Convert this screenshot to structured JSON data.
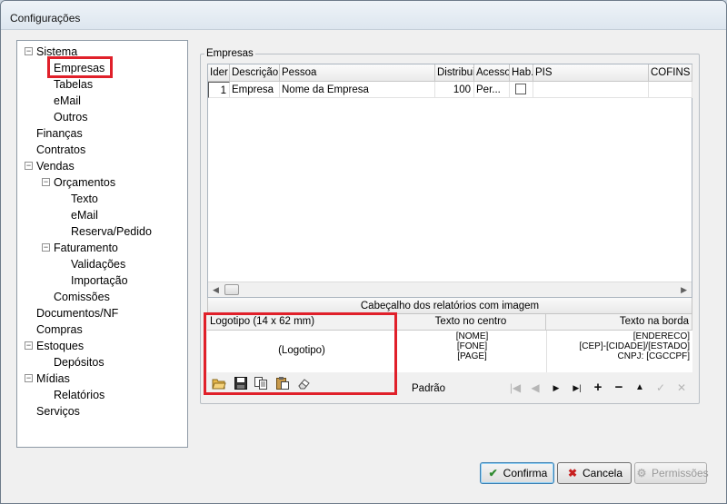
{
  "window": {
    "title": "Configurações"
  },
  "tree": [
    {
      "label": "Sistema",
      "expander": "−"
    },
    {
      "label": "Empresas",
      "selected": true
    },
    {
      "label": "Tabelas"
    },
    {
      "label": "eMail"
    },
    {
      "label": "Outros"
    },
    {
      "label": "Finanças"
    },
    {
      "label": "Contratos"
    },
    {
      "label": "Vendas",
      "expander": "−"
    },
    {
      "label": "Orçamentos",
      "expander": "−"
    },
    {
      "label": "Texto"
    },
    {
      "label": "eMail"
    },
    {
      "label": "Reserva/Pedido"
    },
    {
      "label": "Faturamento",
      "expander": "−"
    },
    {
      "label": "Validações"
    },
    {
      "label": "Importação"
    },
    {
      "label": "Comissões"
    },
    {
      "label": "Documentos/NF"
    },
    {
      "label": "Compras"
    },
    {
      "label": "Estoques",
      "expander": "−"
    },
    {
      "label": "Depósitos"
    },
    {
      "label": "Mídias",
      "expander": "−"
    },
    {
      "label": "Relatórios"
    },
    {
      "label": "Serviços"
    }
  ],
  "empresas": {
    "legend": "Empresas",
    "columns": [
      "Ider",
      "Descrição",
      "Pessoa",
      "Distribui",
      "Acesso",
      "Hab.",
      "PIS",
      "COFINS"
    ],
    "row": {
      "id": "1",
      "descricao": "Empresa",
      "pessoa": "Nome da Empresa",
      "distribui": "100",
      "acesso": "Per...",
      "hab": false
    }
  },
  "report": {
    "title": "Cabeçalho dos relatórios com imagem",
    "logo_header": "Logotipo (14 x 62 mm)",
    "logo_placeholder": "(Logotipo)",
    "center_header": "Texto no centro",
    "center_lines": [
      "[NOME]",
      "[FONE]",
      "[PAGE]"
    ],
    "border_header": "Texto na borda",
    "border_lines": [
      "[ENDERECO]",
      "[CEP]-[CIDADE]/[ESTADO]",
      "CNPJ: [CGCCPF]"
    ],
    "padrao": "Padrão"
  },
  "buttons": {
    "confirma": "Confirma",
    "cancela": "Cancela",
    "permissoes": "Permissões"
  },
  "colors": {
    "highlight": "#e0202a",
    "confirm_check": "#2f8a2f",
    "cancel_x": "#c82020"
  }
}
